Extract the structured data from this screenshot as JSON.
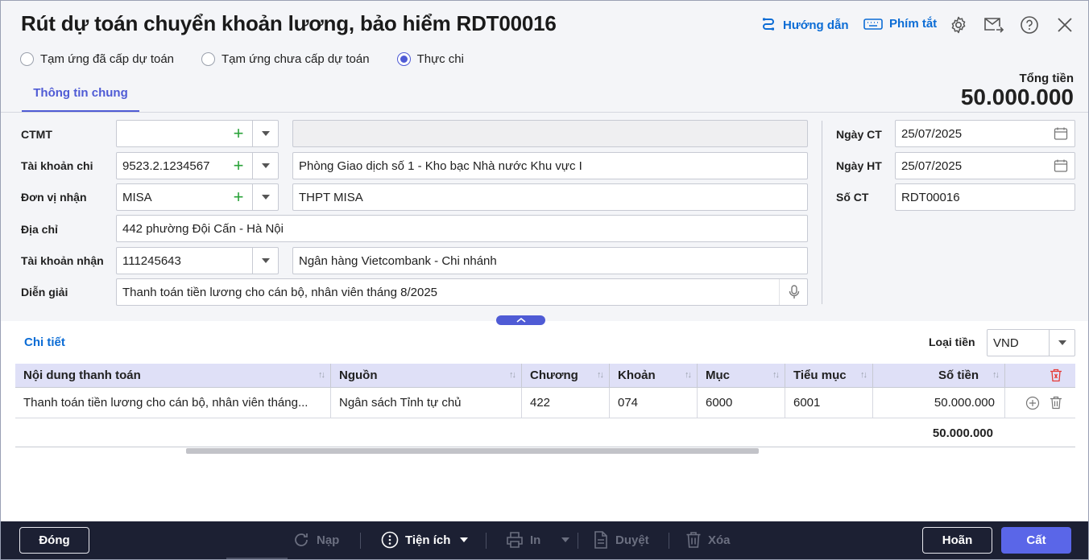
{
  "title": "Rút dự toán chuyển khoản lương, bảo hiểm RDT00016",
  "header_actions": {
    "guide_label": "Hướng dẫn",
    "shortcuts_label": "Phím tắt"
  },
  "payment_types": [
    {
      "label": "Tạm ứng đã cấp dự toán",
      "selected": false
    },
    {
      "label": "Tạm ứng chưa cấp dự toán",
      "selected": false
    },
    {
      "label": "Thực chi",
      "selected": true
    }
  ],
  "tab_general": "Thông tin chung",
  "total": {
    "label": "Tổng tiền",
    "value": "50.000.000"
  },
  "form": {
    "ctmt": {
      "label": "CTMT",
      "code": "",
      "name": ""
    },
    "account_out": {
      "label": "Tài khoản chi",
      "code": "9523.2.1234567",
      "name": "Phòng Giao dịch số 1 - Kho bạc Nhà nước Khu vực I"
    },
    "receiver": {
      "label": "Đơn vị nhận",
      "code": "MISA",
      "name": "THPT MISA"
    },
    "address": {
      "label": "Địa chỉ",
      "value": "442 phường Đội Cấn - Hà Nội"
    },
    "account_in": {
      "label": "Tài khoản nhận",
      "code": "111245643",
      "name": "Ngân hàng Vietcombank - Chi nhánh"
    },
    "description": {
      "label": "Diễn giải",
      "value": "Thanh toán tiền lương cho cán bộ, nhân viên tháng 8/2025"
    }
  },
  "doc_info": {
    "doc_date": {
      "label": "Ngày CT",
      "value": "25/07/2025"
    },
    "post_date": {
      "label": "Ngày HT",
      "value": "25/07/2025"
    },
    "doc_no": {
      "label": "Số CT",
      "value": "RDT00016"
    }
  },
  "detail": {
    "title": "Chi tiết",
    "currency_label": "Loại tiền",
    "currency_value": "VND",
    "columns": [
      "Nội dung thanh toán",
      "Nguồn",
      "Chương",
      "Khoản",
      "Mục",
      "Tiểu mục",
      "Số tiền"
    ],
    "rows": [
      [
        "Thanh toán tiền lương cho cán bộ, nhân viên tháng...",
        "Ngân sách Tỉnh tự chủ",
        "422",
        "074",
        "6000",
        "6001",
        "50.000.000"
      ]
    ],
    "footer_total": "50.000.000"
  },
  "toolbar": {
    "close_label": "Đóng",
    "reload_label": "Nạp",
    "utilities_label": "Tiện ích",
    "print_label": "In",
    "approve_label": "Duyệt",
    "delete_label": "Xóa",
    "cancel_label": "Hoãn",
    "save_label": "Cất"
  },
  "colors": {
    "accent": "#4f5bd5",
    "link": "#0b6cd5",
    "bar": "#1c2033",
    "add": "#2aa33a",
    "delete": "#e53935"
  }
}
